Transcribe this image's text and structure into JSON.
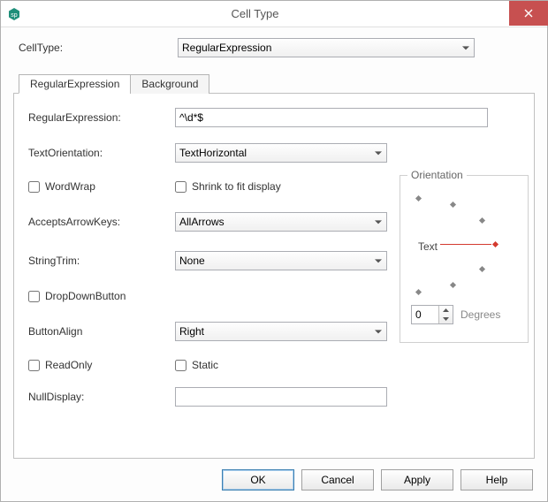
{
  "window": {
    "title": "Cell Type"
  },
  "top": {
    "cellTypeLabel": "CellType:",
    "cellTypeValue": "RegularExpression"
  },
  "tabs": [
    "RegularExpression",
    "Background"
  ],
  "activeTab": 0,
  "form": {
    "regexLabel": "RegularExpression:",
    "regexValue": "^\\d*$",
    "textOrientationLabel": "TextOrientation:",
    "textOrientationValue": "TextHorizontal",
    "wordWrapLabel": "WordWrap",
    "shrinkLabel": "Shrink to fit display",
    "acceptsArrowLabel": "AcceptsArrowKeys:",
    "acceptsArrowValue": "AllArrows",
    "stringTrimLabel": "StringTrim:",
    "stringTrimValue": "None",
    "dropDownLabel": "DropDownButton",
    "buttonAlignLabel": "ButtonAlign",
    "buttonAlignValue": "Right",
    "readOnlyLabel": "ReadOnly",
    "staticLabel": "Static",
    "nullDisplayLabel": "NullDisplay:",
    "nullDisplayValue": ""
  },
  "orientation": {
    "groupTitle": "Orientation",
    "textLabel": "Text",
    "degreesValue": "0",
    "degreesLabel": "Degrees"
  },
  "buttons": {
    "ok": "OK",
    "cancel": "Cancel",
    "apply": "Apply",
    "help": "Help"
  }
}
